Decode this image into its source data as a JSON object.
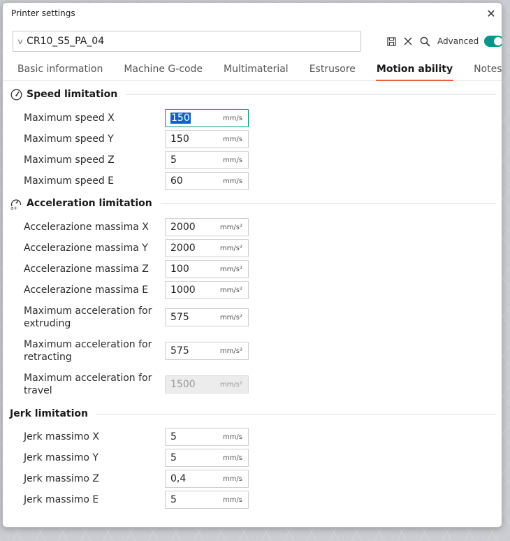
{
  "window": {
    "title": "Printer settings",
    "close_glyph": "✕"
  },
  "preset": {
    "name": "CR10_S5_PA_04",
    "advanced_label": "Advanced",
    "advanced_on": true
  },
  "tabs": [
    {
      "label": "Basic information",
      "active": false
    },
    {
      "label": "Machine G-code",
      "active": false
    },
    {
      "label": "Multimaterial",
      "active": false
    },
    {
      "label": "Estrusore",
      "active": false
    },
    {
      "label": "Motion ability",
      "active": true
    },
    {
      "label": "Notes",
      "active": false
    }
  ],
  "sections": {
    "speed": {
      "title": "Speed limitation",
      "icon": "speedometer-icon",
      "rows": [
        {
          "label": "Maximum speed X",
          "value": "150",
          "unit": "mm/s"
        },
        {
          "label": "Maximum speed Y",
          "value": "150",
          "unit": "mm/s"
        },
        {
          "label": "Maximum speed Z",
          "value": "5",
          "unit": "mm/s"
        },
        {
          "label": "Maximum speed E",
          "value": "60",
          "unit": "mm/s"
        }
      ]
    },
    "accel": {
      "title": "Acceleration limitation",
      "icon": "acceleration-icon",
      "rows": [
        {
          "label": "Accelerazione massima X",
          "value": "2000",
          "unit": "mm/s²"
        },
        {
          "label": "Accelerazione massima Y",
          "value": "2000",
          "unit": "mm/s²"
        },
        {
          "label": "Accelerazione massima Z",
          "value": "100",
          "unit": "mm/s²"
        },
        {
          "label": "Accelerazione massima E",
          "value": "1000",
          "unit": "mm/s²"
        },
        {
          "label_line1": "Maximum acceleration for",
          "label_line2": "extruding",
          "value": "575",
          "unit": "mm/s²"
        },
        {
          "label_line1": "Maximum acceleration for",
          "label_line2": "retracting",
          "value": "575",
          "unit": "mm/s²"
        },
        {
          "label_line1": "Maximum acceleration for",
          "label_line2": "travel",
          "value": "1500",
          "unit": "mm/s²",
          "disabled": true
        }
      ]
    },
    "jerk": {
      "title": "Jerk limitation",
      "rows": [
        {
          "label": "Jerk massimo X",
          "value": "5",
          "unit": "mm/s"
        },
        {
          "label": "Jerk massimo Y",
          "value": "5",
          "unit": "mm/s"
        },
        {
          "label": "Jerk massimo Z",
          "value": "0,4",
          "unit": "mm/s"
        },
        {
          "label": "Jerk massimo E",
          "value": "5",
          "unit": "mm/s"
        }
      ]
    }
  },
  "colors": {
    "accent": "#009688",
    "tab_underline": "#e8603c",
    "selection": "#0a64c8"
  }
}
